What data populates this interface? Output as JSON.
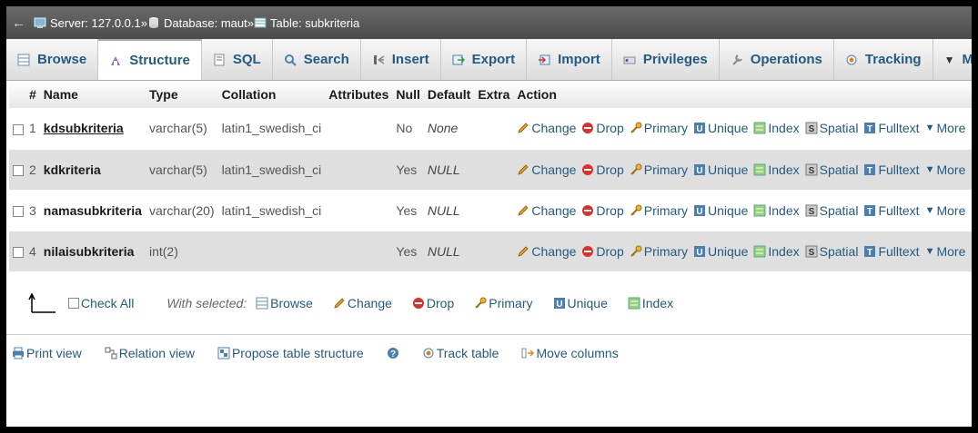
{
  "breadcrumb": {
    "server": "Server: 127.0.0.1",
    "database": "Database: maut",
    "table": "Table: subkriteria",
    "separator": "»"
  },
  "tabs": [
    {
      "label": "Browse",
      "icon": "browse-icon"
    },
    {
      "label": "Structure",
      "icon": "structure-icon",
      "active": true
    },
    {
      "label": "SQL",
      "icon": "sql-icon"
    },
    {
      "label": "Search",
      "icon": "search-icon"
    },
    {
      "label": "Insert",
      "icon": "insert-icon"
    },
    {
      "label": "Export",
      "icon": "export-icon"
    },
    {
      "label": "Import",
      "icon": "import-icon"
    },
    {
      "label": "Privileges",
      "icon": "privileges-icon"
    },
    {
      "label": "Operations",
      "icon": "operations-icon"
    },
    {
      "label": "Tracking",
      "icon": "tracking-icon"
    },
    {
      "label": "More",
      "icon": "triangle-down-icon"
    }
  ],
  "table": {
    "headers": [
      "#",
      "Name",
      "Type",
      "Collation",
      "Attributes",
      "Null",
      "Default",
      "Extra",
      "Action"
    ],
    "rows": [
      {
        "num": "1",
        "name": "kdsubkriteria",
        "type": "varchar(5)",
        "collation": "latin1_swedish_ci",
        "attributes": "",
        "null": "No",
        "default": "None",
        "extra": ""
      },
      {
        "num": "2",
        "name": "kdkriteria",
        "type": "varchar(5)",
        "collation": "latin1_swedish_ci",
        "attributes": "",
        "null": "Yes",
        "default": "NULL",
        "extra": ""
      },
      {
        "num": "3",
        "name": "namasubkriteria",
        "type": "varchar(20)",
        "collation": "latin1_swedish_ci",
        "attributes": "",
        "null": "Yes",
        "default": "NULL",
        "extra": ""
      },
      {
        "num": "4",
        "name": "nilaisubkriteria",
        "type": "int(2)",
        "collation": "",
        "attributes": "",
        "null": "Yes",
        "default": "NULL",
        "extra": ""
      }
    ],
    "row_actions": {
      "change": "Change",
      "drop": "Drop",
      "primary": "Primary",
      "unique": "Unique",
      "index": "Index",
      "spatial": "Spatial",
      "fulltext": "Fulltext",
      "more": "More"
    }
  },
  "with_selected": {
    "check_all": "Check All",
    "label": "With selected:",
    "browse": "Browse",
    "change": "Change",
    "drop": "Drop",
    "primary": "Primary",
    "unique": "Unique",
    "index": "Index"
  },
  "footer_links": {
    "print_view": "Print view",
    "relation_view": "Relation view",
    "propose": "Propose table structure",
    "track_table": "Track table",
    "move_columns": "Move columns"
  },
  "colors": {
    "link": "#235a81",
    "header_bar": "#5a5a5a",
    "row_alt": "#dfdfdf"
  }
}
